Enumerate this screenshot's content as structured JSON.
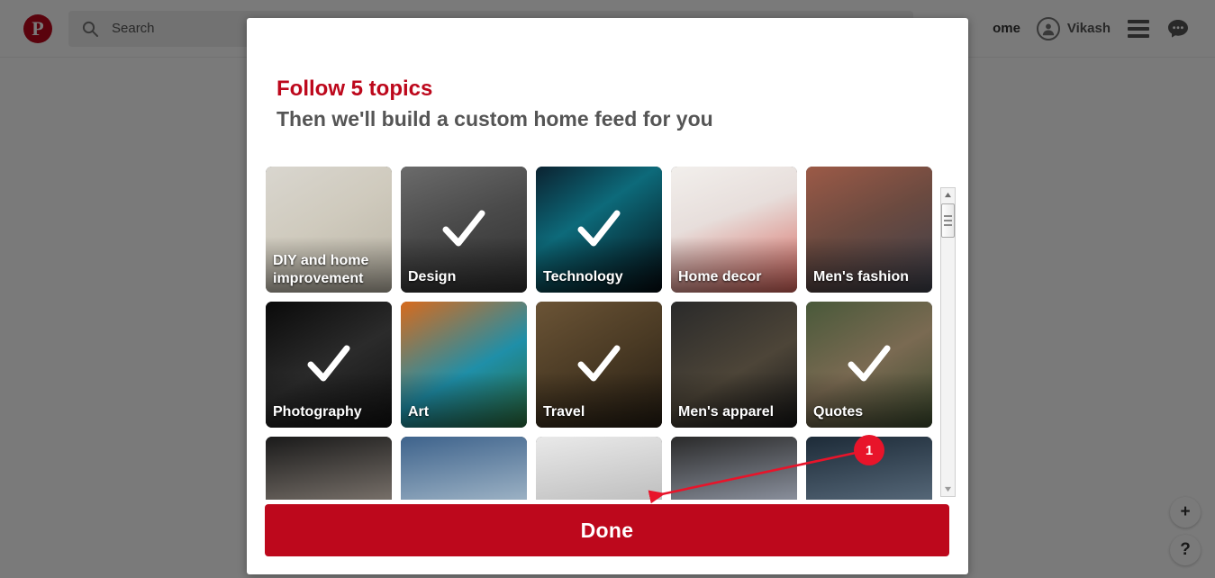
{
  "header": {
    "logo_icon": "pinterest-logo-icon",
    "logo_glyph": "P",
    "search": {
      "icon": "search-icon",
      "placeholder": "Search",
      "value": ""
    },
    "home_link": "ome",
    "user": {
      "name": "Vikash",
      "avatar_icon": "user-avatar-icon"
    },
    "menu_icon": "hamburger-menu-icon",
    "messages_icon": "chat-bubble-icon"
  },
  "floating_buttons": [
    {
      "name": "add-button",
      "label": "+"
    },
    {
      "name": "help-button",
      "label": "?"
    }
  ],
  "modal": {
    "title": "Follow 5 topics",
    "subtitle": "Then we'll build a custom home feed for you",
    "done_label": "Done",
    "accent_color": "#bd081c",
    "scrollbar": {
      "up_arrow": "scroll-up-arrow-icon",
      "down_arrow": "scroll-down-arrow-icon",
      "thumb": "scrollbar-thumb"
    },
    "topics": [
      {
        "label": "DIY and home improvement",
        "selected": false,
        "two_line": true
      },
      {
        "label": "Design",
        "selected": true,
        "two_line": false
      },
      {
        "label": "Technology",
        "selected": true,
        "two_line": false
      },
      {
        "label": "Home decor",
        "selected": false,
        "two_line": false
      },
      {
        "label": "Men's fashion",
        "selected": false,
        "two_line": false
      },
      {
        "label": "Photography",
        "selected": true,
        "two_line": false
      },
      {
        "label": "Art",
        "selected": false,
        "two_line": false
      },
      {
        "label": "Travel",
        "selected": true,
        "two_line": false
      },
      {
        "label": "Men's apparel",
        "selected": false,
        "two_line": false
      },
      {
        "label": "Quotes",
        "selected": true,
        "two_line": false
      },
      {
        "label": "",
        "selected": false,
        "two_line": false
      },
      {
        "label": "",
        "selected": false,
        "two_line": false
      },
      {
        "label": "",
        "selected": false,
        "two_line": false
      },
      {
        "label": "",
        "selected": false,
        "two_line": false
      },
      {
        "label": "",
        "selected": false,
        "two_line": false
      }
    ]
  },
  "annotation": {
    "step_number": "1",
    "color": "#e8142a"
  }
}
